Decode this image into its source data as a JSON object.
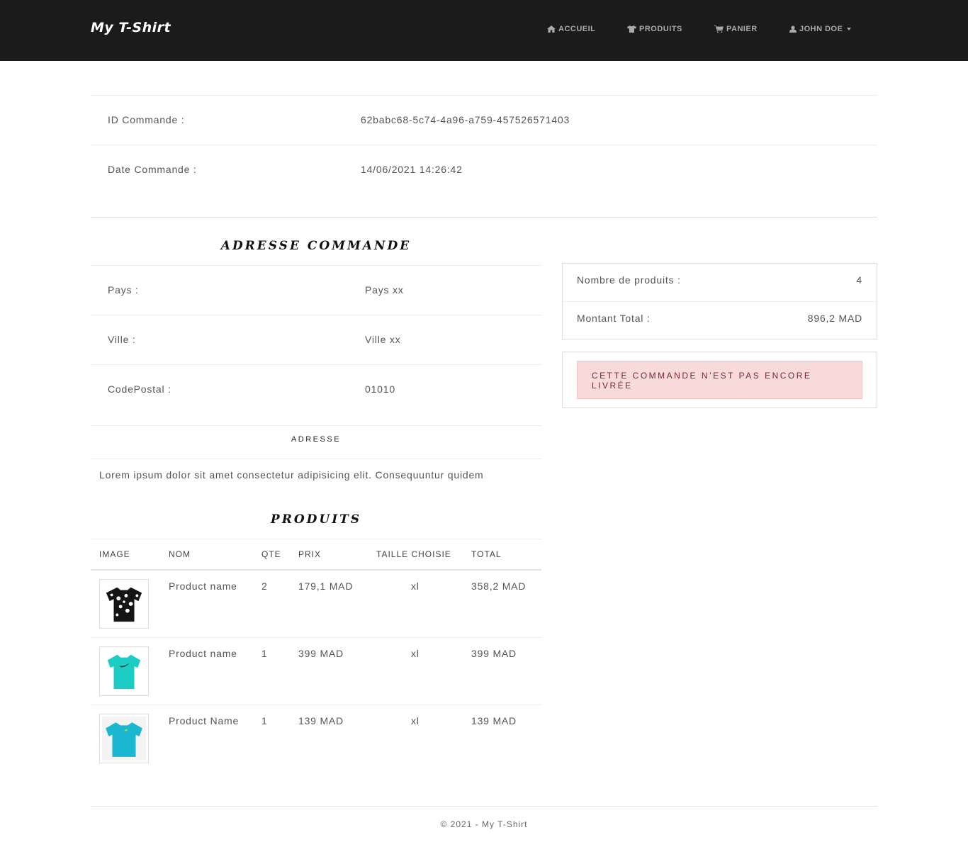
{
  "navbar": {
    "brand": "My T-Shirt",
    "items": [
      {
        "label": "Accueil",
        "icon": "home-icon"
      },
      {
        "label": "Produits",
        "icon": "tshirt-icon"
      },
      {
        "label": "Panier",
        "icon": "cart-icon"
      },
      {
        "label": "John Doe",
        "icon": "user-icon"
      }
    ]
  },
  "order": {
    "id_label": "ID Commande :",
    "id_value": "62babc68-5c74-4a96-a759-457526571403",
    "date_label": "Date Commande :",
    "date_value": "14/06/2021 14:26:42"
  },
  "address": {
    "title": "Adresse Commande",
    "rows": [
      {
        "label": "Pays :",
        "value": "Pays xx"
      },
      {
        "label": "Ville :",
        "value": "Ville xx"
      },
      {
        "label": "CodePostal :",
        "value": "01010"
      }
    ],
    "adresse_heading": "Adresse",
    "adresse_text": "Lorem ipsum dolor sit amet consectetur adipisicing elit. Consequuntur quidem"
  },
  "summary": {
    "count_label": "Nombre de produits :",
    "count_value": "4",
    "total_label": "Montant Total :",
    "total_value": "896,2 MAD",
    "status_message": "Cette commande n’est pas encore livrée",
    "status_color": "#f8dadb"
  },
  "products": {
    "title": "Produits",
    "columns": [
      "Image",
      "Nom",
      "Qte",
      "Prix",
      "Taille Choisie",
      "Total"
    ],
    "rows": [
      {
        "name": "Product name",
        "qty": "2",
        "price": "179,1 MAD",
        "size": "xl",
        "total": "358,2 MAD",
        "image": "black-printed-tshirt",
        "color": "#151515"
      },
      {
        "name": "Product name",
        "qty": "1",
        "price": "399 MAD",
        "size": "xl",
        "total": "399 MAD",
        "image": "teal-tshirt",
        "color": "#1ccdc5"
      },
      {
        "name": "Product Name",
        "qty": "1",
        "price": "139 MAD",
        "size": "xl",
        "total": "139 MAD",
        "image": "cyan-tshirt",
        "color": "#1ab8d0"
      }
    ]
  },
  "footer": {
    "text": "© 2021 - My T-Shirt"
  }
}
